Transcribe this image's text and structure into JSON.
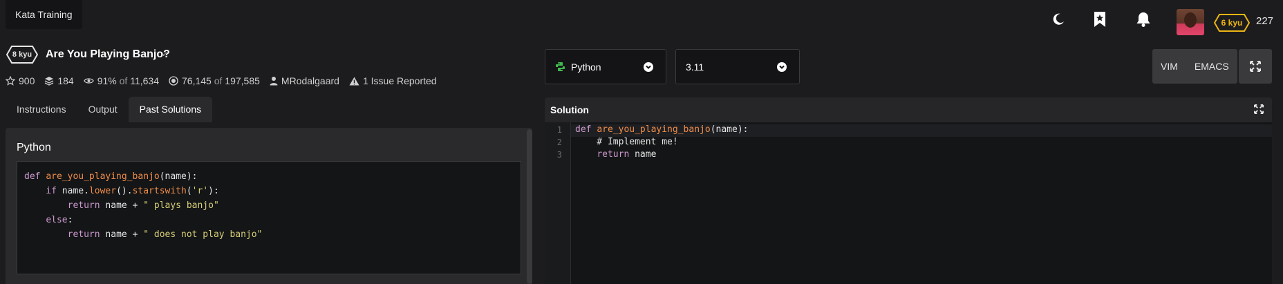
{
  "topbar": {
    "brand_tab": "Kata Training",
    "icons": [
      "moon-icon",
      "bookmark-star-icon",
      "bell-icon"
    ],
    "rank_badge": "6 kyu",
    "honor": "227"
  },
  "kata": {
    "kyu": "8 kyu",
    "title": "Are You Playing Banjo?",
    "stats": {
      "stars": "900",
      "collections": "184",
      "satisfaction_pct": "91%",
      "satisfaction_of": "of",
      "satisfaction_votes": "11,634",
      "completed": "76,145",
      "completed_of": "of",
      "attempted": "197,585",
      "author": "MRodalgaard",
      "issues": "1 Issue Reported"
    }
  },
  "tabs": [
    {
      "label": "Instructions",
      "active": false
    },
    {
      "label": "Output",
      "active": false
    },
    {
      "label": "Past Solutions",
      "active": true
    }
  ],
  "past_solution": {
    "language": "Python",
    "code": [
      "def are_you_playing_banjo(name):",
      "    if name.lower().startswith('r'):",
      "        return name + \" plays banjo\"",
      "    else:",
      "        return name + \" does not play banjo\""
    ]
  },
  "editor_controls": {
    "language": "Python",
    "version": "3.11",
    "modes": [
      "VIM",
      "EMACS"
    ]
  },
  "solution": {
    "title": "Solution",
    "line_numbers": [
      "1",
      "2",
      "3"
    ],
    "code": [
      "def are_you_playing_banjo(name):",
      "    # Implement me!",
      "    return name"
    ]
  },
  "colors": {
    "background": "#1c1c1e",
    "panel": "#2a2a2c",
    "code_bg": "#141517",
    "keyword": "#cc99cd",
    "function": "#f08d49",
    "string": "#d6d077",
    "rank_yellow": "#ecb613",
    "python_green": "#3fb950"
  }
}
